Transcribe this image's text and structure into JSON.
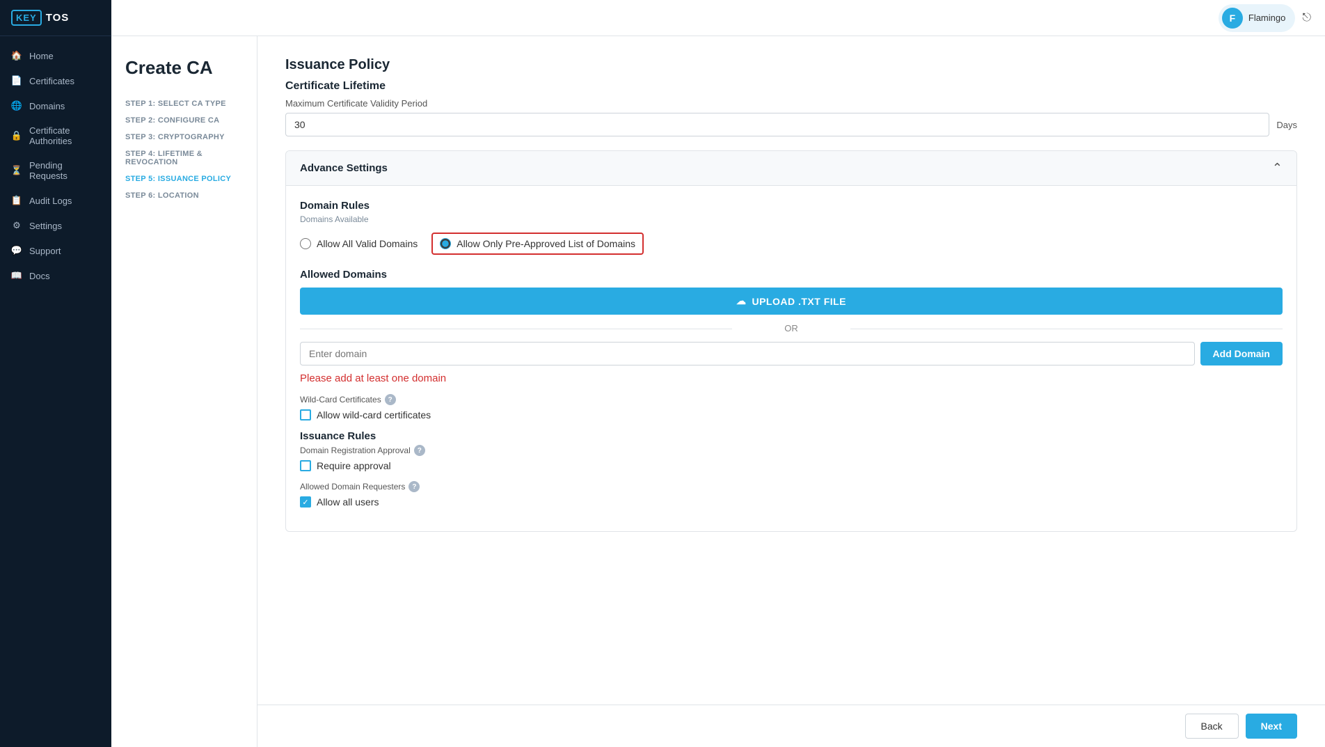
{
  "sidebar": {
    "logo_key": "KEY",
    "logo_tos": "TOS",
    "items": [
      {
        "id": "home",
        "label": "Home",
        "icon": "🏠"
      },
      {
        "id": "certificates",
        "label": "Certificates",
        "icon": "📄"
      },
      {
        "id": "domains",
        "label": "Domains",
        "icon": "🌐"
      },
      {
        "id": "certificate-authorities",
        "label": "Certificate Authorities",
        "icon": "🔒"
      },
      {
        "id": "pending-requests",
        "label": "Pending Requests",
        "icon": "⏳"
      },
      {
        "id": "audit-logs",
        "label": "Audit Logs",
        "icon": "📋"
      },
      {
        "id": "settings",
        "label": "Settings",
        "icon": "⚙"
      },
      {
        "id": "support",
        "label": "Support",
        "icon": "💬"
      },
      {
        "id": "docs",
        "label": "Docs",
        "icon": "📖"
      }
    ]
  },
  "topbar": {
    "user_initial": "F",
    "user_name": "Flamingo",
    "logout_icon": "⎋"
  },
  "page": {
    "title": "Create CA",
    "steps": [
      {
        "id": "step1",
        "label": "STEP 1: SELECT CA TYPE",
        "active": false
      },
      {
        "id": "step2",
        "label": "STEP 2: CONFIGURE CA",
        "active": false
      },
      {
        "id": "step3",
        "label": "STEP 3: CRYPTOGRAPHY",
        "active": false
      },
      {
        "id": "step4",
        "label": "STEP 4: LIFETIME & REVOCATION",
        "active": false
      },
      {
        "id": "step5",
        "label": "STEP 5: ISSUANCE POLICY",
        "active": true
      },
      {
        "id": "step6",
        "label": "STEP 6: LOCATION",
        "active": false
      }
    ]
  },
  "form": {
    "issuance_policy_title": "Issuance Policy",
    "cert_lifetime_title": "Certificate Lifetime",
    "max_validity_label": "Maximum Certificate Validity Period",
    "validity_value": "30",
    "validity_unit": "Days",
    "advance_settings_title": "Advance Settings",
    "domain_rules_title": "Domain Rules",
    "domains_available_label": "Domains Available",
    "radio_option1_label": "Allow All Valid Domains",
    "radio_option2_label": "Allow Only Pre-Approved List of Domains",
    "radio_option2_selected": true,
    "allowed_domains_title": "Allowed Domains",
    "upload_btn_label": "UPLOAD .TXT FILE",
    "or_text": "OR",
    "domain_placeholder": "Enter domain",
    "add_domain_btn": "Add Domain",
    "error_text": "Please add at least one domain",
    "wildcard_section_label": "Wild-Card Certificates",
    "wildcard_checkbox_label": "Allow wild-card certificates",
    "wildcard_checked": false,
    "issuance_rules_title": "Issuance Rules",
    "domain_reg_approval_label": "Domain Registration Approval",
    "require_approval_label": "Require approval",
    "require_approval_checked": false,
    "allowed_domain_requesters_label": "Allowed Domain Requesters",
    "allow_all_users_label": "Allow all users",
    "allow_all_users_checked": true,
    "back_btn": "Back",
    "next_btn": "Next"
  }
}
